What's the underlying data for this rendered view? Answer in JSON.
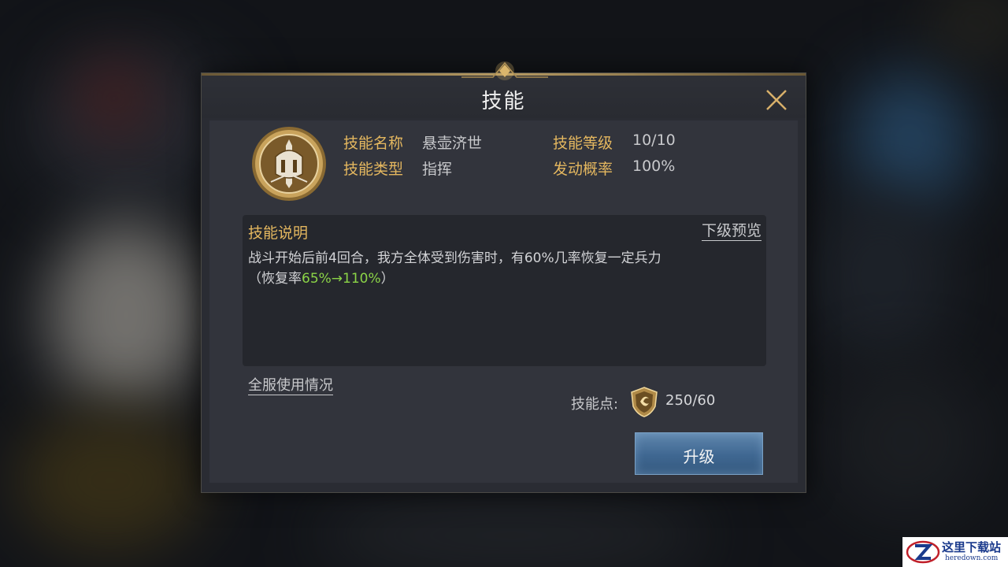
{
  "dialog": {
    "title": "技能",
    "close_icon": "close-x-icon"
  },
  "skill": {
    "icon": "helmet-sword-emblem-icon",
    "name_label": "技能名称",
    "name_value": "悬壶济世",
    "level_label": "技能等级",
    "level_value": "10/10",
    "type_label": "技能类型",
    "type_value": "指挥",
    "chance_label": "发动概率",
    "chance_value": "100%"
  },
  "description": {
    "title": "技能说明",
    "preview_link": "下级预览",
    "text_line1": "战斗开始后前4回合，我方全体受到伤害时，有60%几率恢复一定兵力",
    "text_line2_prefix": "（恢复率",
    "text_line2_highlight": "65%→110%",
    "text_line2_suffix": "）"
  },
  "footer": {
    "usage_link": "全服使用情况",
    "points_label": "技能点:",
    "points_icon": "skill-point-shield-icon",
    "points_value": "250/60",
    "upgrade_button": "升级"
  },
  "watermark": {
    "text": "这里下载站",
    "sub": "heredown.com"
  },
  "colors": {
    "label_gold": "#e4b75f",
    "highlight_green": "#8bd447",
    "button_blue": "#3f6791"
  }
}
